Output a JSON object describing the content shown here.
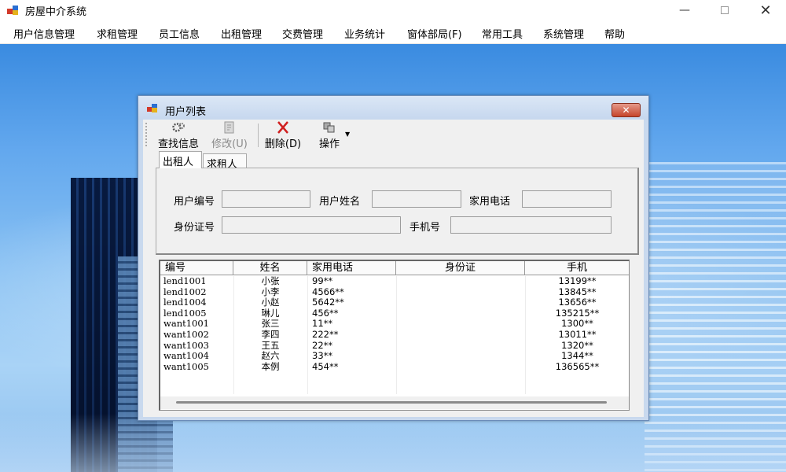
{
  "window": {
    "title": "房屋中介系统"
  },
  "menu": [
    "用户信息管理",
    "求租管理",
    "员工信息",
    "出租管理",
    "交费管理",
    "业务统计",
    "窗体部局(F)",
    "常用工具",
    "系统管理",
    "帮助"
  ],
  "child": {
    "title": "用户列表",
    "toolbar": {
      "find": "查找信息",
      "edit": "修改(U)",
      "delete": "删除(D)",
      "ops": "操作"
    },
    "tabs": [
      "出租人",
      "求租人"
    ],
    "form": {
      "user_id": "用户编号",
      "user_name": "用户姓名",
      "home_phone": "家用电话",
      "id_card": "身份证号",
      "mobile": "手机号"
    },
    "grid": {
      "columns": [
        "编号",
        "姓名",
        "家用电话",
        "身份证",
        "手机"
      ],
      "rows": [
        [
          "lend1001",
          "小张",
          "99**",
          "",
          "13199**"
        ],
        [
          "lend1002",
          "小李",
          "4566**",
          "",
          "13845**"
        ],
        [
          "lend1004",
          "小赵",
          "5642**",
          "",
          "13656**"
        ],
        [
          "lend1005",
          "琳儿",
          "456**",
          "",
          "135215**"
        ],
        [
          "want1001",
          "张三",
          "11**",
          "",
          "1300**"
        ],
        [
          "want1002",
          "李四",
          "222**",
          "",
          "13011**"
        ],
        [
          "want1003",
          "王五",
          "22**",
          "",
          "1320**"
        ],
        [
          "want1004",
          "赵六",
          "33**",
          "",
          "1344**"
        ],
        [
          "want1005",
          "本例",
          "454**",
          "",
          "136565**"
        ]
      ]
    }
  }
}
